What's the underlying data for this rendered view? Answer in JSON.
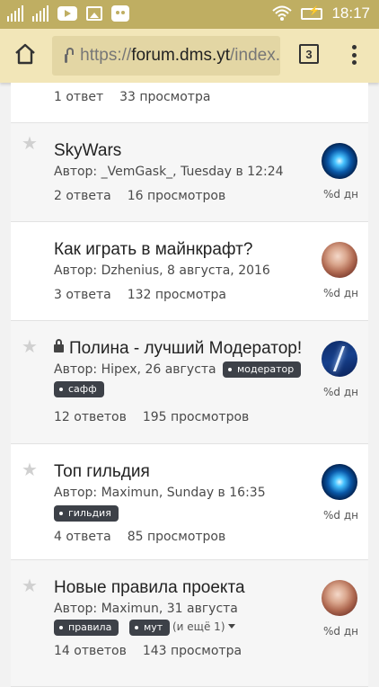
{
  "statusbar": {
    "time": "18:17",
    "icons": [
      "signal-icon",
      "youtube-icon",
      "gallery-icon",
      "robot-icon",
      "wifi-icon",
      "battery-charging-icon"
    ]
  },
  "browser": {
    "url_prefix": "https://",
    "url_host": "forum.dms.yt",
    "url_rest": "/index.",
    "tab_count": "3"
  },
  "topics": [
    {
      "title": "",
      "author": "",
      "replies": "1 ответ",
      "views": "33 просмотра",
      "age": ""
    },
    {
      "title": "SkyWars",
      "author": "Автор: _VemGask_, Tuesday в 12:24",
      "replies": "2 ответа",
      "views": "16 просмотров",
      "age": "%d дн"
    },
    {
      "title": "Как играть в майнкрафт?",
      "author": "Автор: Dzhenius, 8 августа, 2016",
      "replies": "3 ответа",
      "views": "132 просмотра",
      "age": "%d дн"
    },
    {
      "title": "Полина - лучший Модератор!",
      "author": "Автор: Hipex, 26 августа",
      "tags": [
        "модератор",
        "сафф"
      ],
      "replies": "12 ответов",
      "views": "195 просмотров",
      "age": "%d дн"
    },
    {
      "title": "Топ гильдия",
      "author": "Автор: Maximun, Sunday в 16:35",
      "tags": [
        "гильдия"
      ],
      "replies": "4 ответа",
      "views": "85 просмотров",
      "age": "%d дн"
    },
    {
      "title": "Новые правила проекта",
      "author": "Автор: Maximun, 31 августа",
      "tags": [
        "правила",
        "мут"
      ],
      "more": "(и ещё 1)",
      "replies": "14 ответов",
      "views": "143 просмотра",
      "age": "%d дн"
    }
  ],
  "colors": {
    "statusbar": "#bfae62",
    "toolbar": "#f2e6b8",
    "tag": "#3d4148"
  }
}
